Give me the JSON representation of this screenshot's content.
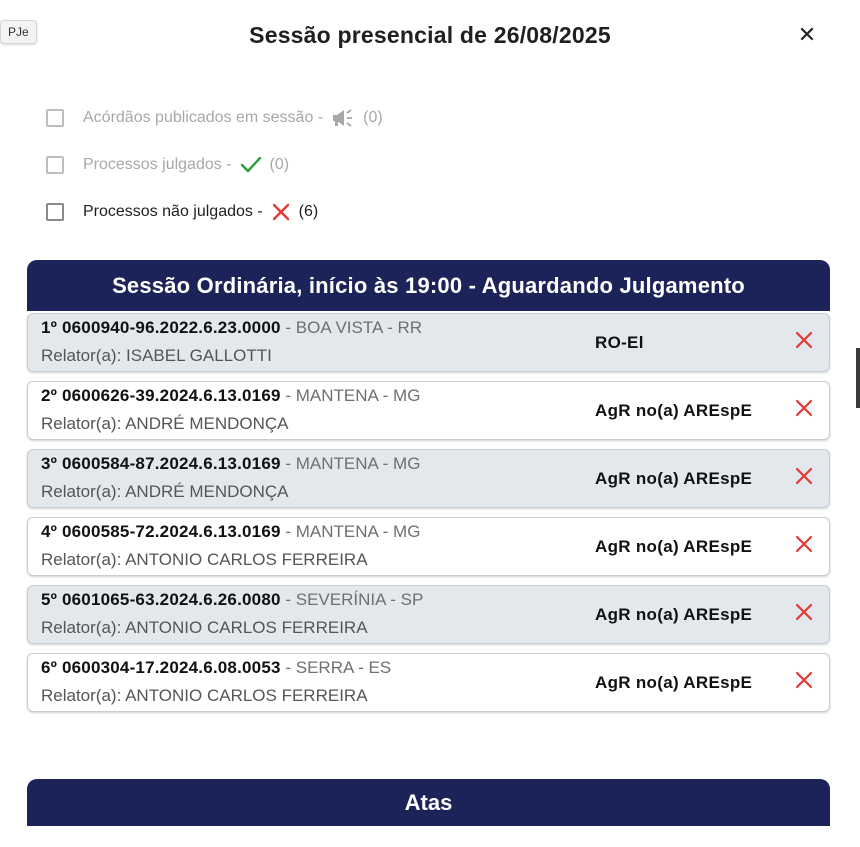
{
  "app_tag": "PJe",
  "dialog": {
    "title": "Sessão presencial de 26/08/2025",
    "close_glyph": "✕"
  },
  "filters": [
    {
      "label": "Acórdãos publicados em sessão -",
      "count": "(0)",
      "icon": "megaphone-icon",
      "disabled": true
    },
    {
      "label": "Processos julgados -",
      "count": "(0)",
      "icon": "check-icon",
      "disabled": true
    },
    {
      "label": "Processos não julgados -",
      "count": "(6)",
      "icon": "cross-icon",
      "disabled": false
    }
  ],
  "session": {
    "header": "Sessão Ordinária, início às 19:00 - Aguardando Julgamento"
  },
  "cases": [
    {
      "number": "1º 0600940-96.2022.6.23.0000",
      "location": "- BOA VISTA - RR",
      "rapporteur": "Relator(a): ISABEL GALLOTTI",
      "class": "RO-El",
      "status_icon": "cross-icon"
    },
    {
      "number": "2º 0600626-39.2024.6.13.0169",
      "location": "- MANTENA - MG",
      "rapporteur": "Relator(a): ANDRÉ MENDONÇA",
      "class": "AgR no(a) AREspE",
      "status_icon": "cross-icon"
    },
    {
      "number": "3º 0600584-87.2024.6.13.0169",
      "location": "- MANTENA - MG",
      "rapporteur": "Relator(a): ANDRÉ MENDONÇA",
      "class": "AgR no(a) AREspE",
      "status_icon": "cross-icon"
    },
    {
      "number": "4º 0600585-72.2024.6.13.0169",
      "location": "- MANTENA - MG",
      "rapporteur": "Relator(a): ANTONIO CARLOS FERREIRA",
      "class": "AgR no(a) AREspE",
      "status_icon": "cross-icon"
    },
    {
      "number": "5º 0601065-63.2024.6.26.0080",
      "location": "- SEVERÍNIA - SP",
      "rapporteur": "Relator(a): ANTONIO CARLOS FERREIRA",
      "class": "AgR no(a) AREspE",
      "status_icon": "cross-icon"
    },
    {
      "number": "6º 0600304-17.2024.6.08.0053",
      "location": "- SERRA - ES",
      "rapporteur": "Relator(a): ANTONIO CARLOS FERREIRA",
      "class": "AgR no(a) AREspE",
      "status_icon": "cross-icon"
    }
  ],
  "atas": {
    "header": "Atas"
  },
  "colors": {
    "header_navy": "#1c2359",
    "cross_red": "#e53935",
    "check_green": "#2e9d3a",
    "row_shaded": "#e3e8ec"
  }
}
